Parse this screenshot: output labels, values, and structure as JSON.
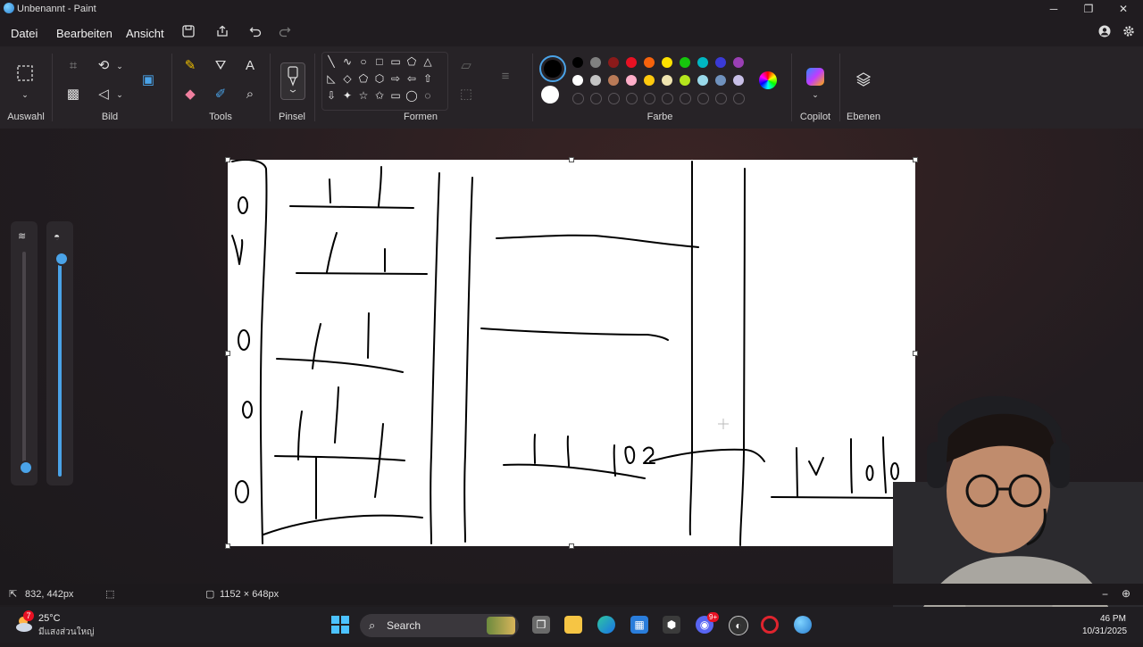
{
  "window": {
    "title": "Unbenannt - Paint",
    "controls": {
      "minimize": "─",
      "maximize": "❐",
      "close": "✕"
    }
  },
  "menu": {
    "file": "Datei",
    "edit": "Bearbeiten",
    "view": "Ansicht"
  },
  "ribbon": {
    "groups": {
      "selection": "Auswahl",
      "image": "Bild",
      "tools": "Tools",
      "brushes": "Pinsel",
      "shapes": "Formen",
      "colors": "Farbe",
      "copilot": "Copilot",
      "layers": "Ebenen"
    },
    "shapes_row1": [
      "╲",
      "∿",
      "○",
      "□",
      "▭",
      "⬠",
      "△"
    ],
    "shapes_row2": [
      "◺",
      "◇",
      "⬠",
      "⬡",
      "⇨",
      "⇦",
      "⇧"
    ],
    "shapes_row3": [
      "⇩",
      "✦",
      "☆",
      "✩",
      "▭",
      "◯",
      "◌"
    ],
    "palette_row1": [
      "#000000",
      "#808080",
      "#8b1a1a",
      "#e81123",
      "#f7630c",
      "#fce100",
      "#16c60c",
      "#00b7c3",
      "#3a3ad6",
      "#9a3fb4"
    ],
    "palette_row2": [
      "#ffffff",
      "#c3c3c3",
      "#b97a57",
      "#ffaec9",
      "#ffc90e",
      "#efe4b0",
      "#b5e61d",
      "#99d9ea",
      "#7092be",
      "#c8bfe7"
    ],
    "primary_color": "#000000",
    "secondary_color": "#ffffff"
  },
  "status": {
    "cursor_pos": "832, 442px",
    "canvas_size": "1152 × 648px"
  },
  "taskbar": {
    "weather_temp": "25°C",
    "weather_loc": "มีแสงส่วนใหญ่",
    "weather_badge": "7",
    "search_label": "Search",
    "time": "46 PM",
    "date": "10/31/2025",
    "discord_badge": "9+"
  }
}
